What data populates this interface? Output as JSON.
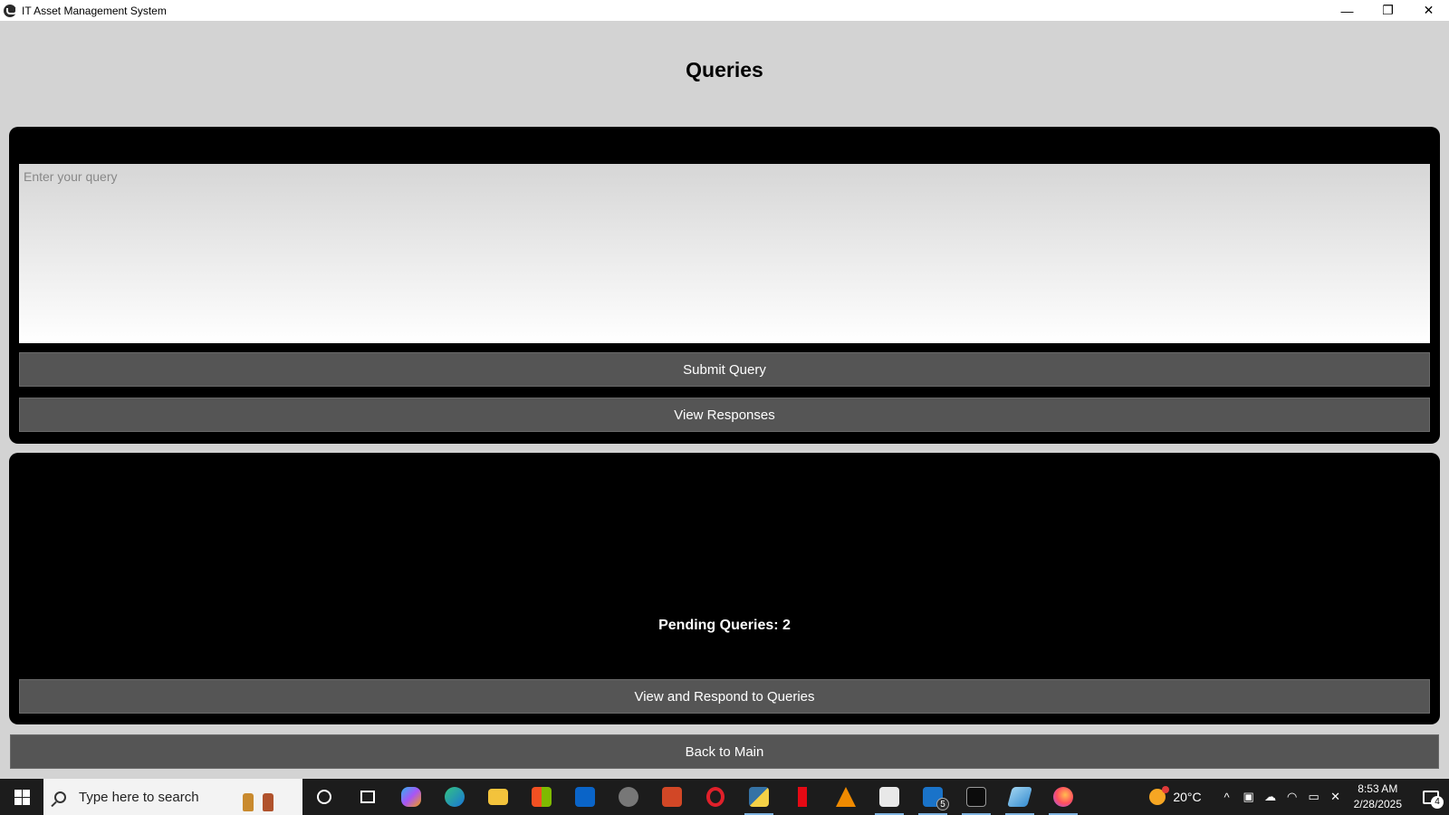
{
  "window": {
    "title": "IT Asset Management System",
    "minimize_glyph": "—",
    "maximize_glyph": "❐",
    "close_glyph": "✕"
  },
  "page": {
    "heading": "Queries"
  },
  "query_panel": {
    "input_placeholder": "Enter your query",
    "input_value": "",
    "submit_label": "Submit Query",
    "view_responses_label": "View Responses"
  },
  "admin_panel": {
    "pending_text": "Pending Queries: 2",
    "respond_label": "View and Respond to Queries"
  },
  "footer": {
    "back_label": "Back to Main"
  },
  "taskbar": {
    "search_placeholder": "Type here to search",
    "icons": [
      "cortana-icon",
      "task-view-icon",
      "copilot-icon",
      "edge-icon",
      "file-explorer-icon",
      "store-icon",
      "outlook-icon",
      "app-icon",
      "powerpoint-icon",
      "opera-icon",
      "python-icon",
      "netflix-icon",
      "vlc-icon",
      "notepad-icon",
      "mail-icon",
      "terminal-icon",
      "app2-icon",
      "firefox-icon"
    ],
    "mail_badge": "5",
    "weather": "20°C",
    "time": "8:53 AM",
    "date": "2/28/2025",
    "notification_count": "4"
  }
}
